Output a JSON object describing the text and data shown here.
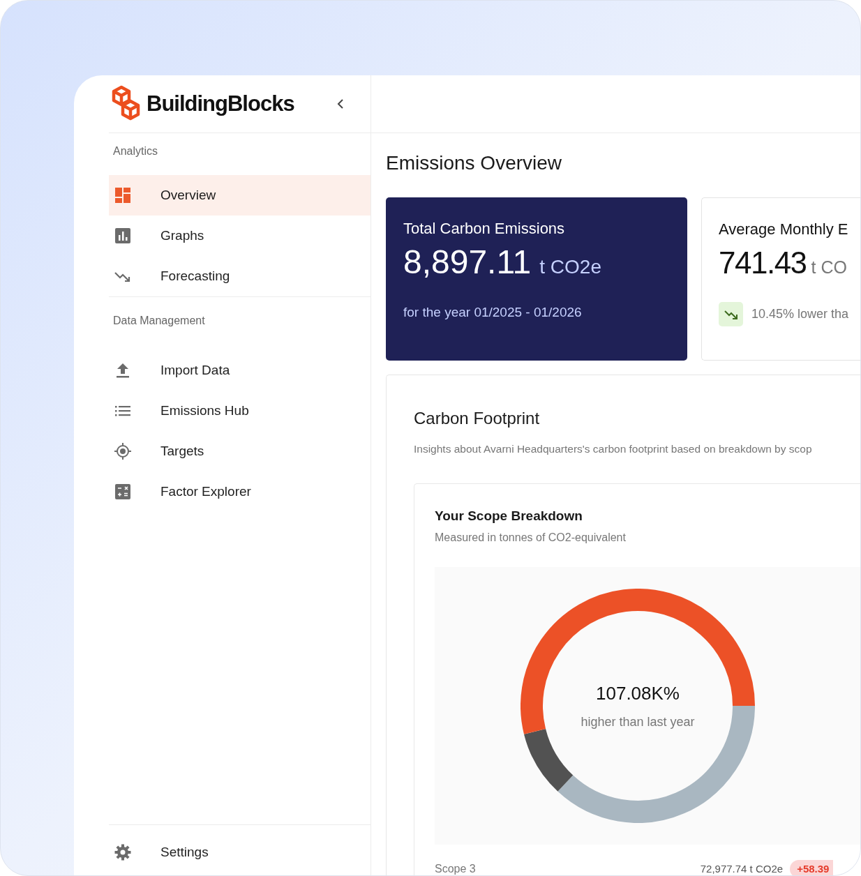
{
  "brand": {
    "name": "BuildingBlocks"
  },
  "sidebar": {
    "sections": [
      {
        "title": "Analytics",
        "items": [
          {
            "label": "Overview",
            "kind": "dashboard",
            "selected": true
          },
          {
            "label": "Graphs",
            "kind": "bars",
            "selected": false
          },
          {
            "label": "Forecasting",
            "kind": "trend",
            "selected": false
          }
        ]
      },
      {
        "title": "Data Management",
        "items": [
          {
            "label": "Import Data",
            "kind": "upload",
            "selected": false
          },
          {
            "label": "Emissions Hub",
            "kind": "list",
            "selected": false
          },
          {
            "label": "Targets",
            "kind": "target",
            "selected": false
          },
          {
            "label": "Factor Explorer",
            "kind": "calculator",
            "selected": false
          }
        ]
      }
    ],
    "footer_item": {
      "label": "Settings",
      "kind": "settings",
      "selected": false
    }
  },
  "page": {
    "title": "Emissions Overview"
  },
  "stat_cards": [
    {
      "kind": "highlight",
      "title": "Total Carbon Emissions",
      "value": "8,897.11",
      "unit": "t CO2e",
      "note": "for the year 01/2025 - 01/2026"
    },
    {
      "kind": "plain",
      "title": "Average Monthly E",
      "value": "741.43",
      "unit": "t CO",
      "trend": "10.45% lower tha"
    }
  ],
  "footprint": {
    "title": "Carbon Footprint",
    "subtitle": "Insights about Avarni Headquarters's carbon footprint based on breakdown by scop",
    "breakdown": {
      "title": "Your Scope Breakdown",
      "subtitle": "Measured in tonnes of CO2-equivalent",
      "center_value": "107.08K%",
      "center_label": "higher than last year",
      "rows": [
        {
          "label": "Scope 3",
          "value": "72,977.74 t CO2e",
          "change": "+58.39"
        }
      ]
    }
  }
}
